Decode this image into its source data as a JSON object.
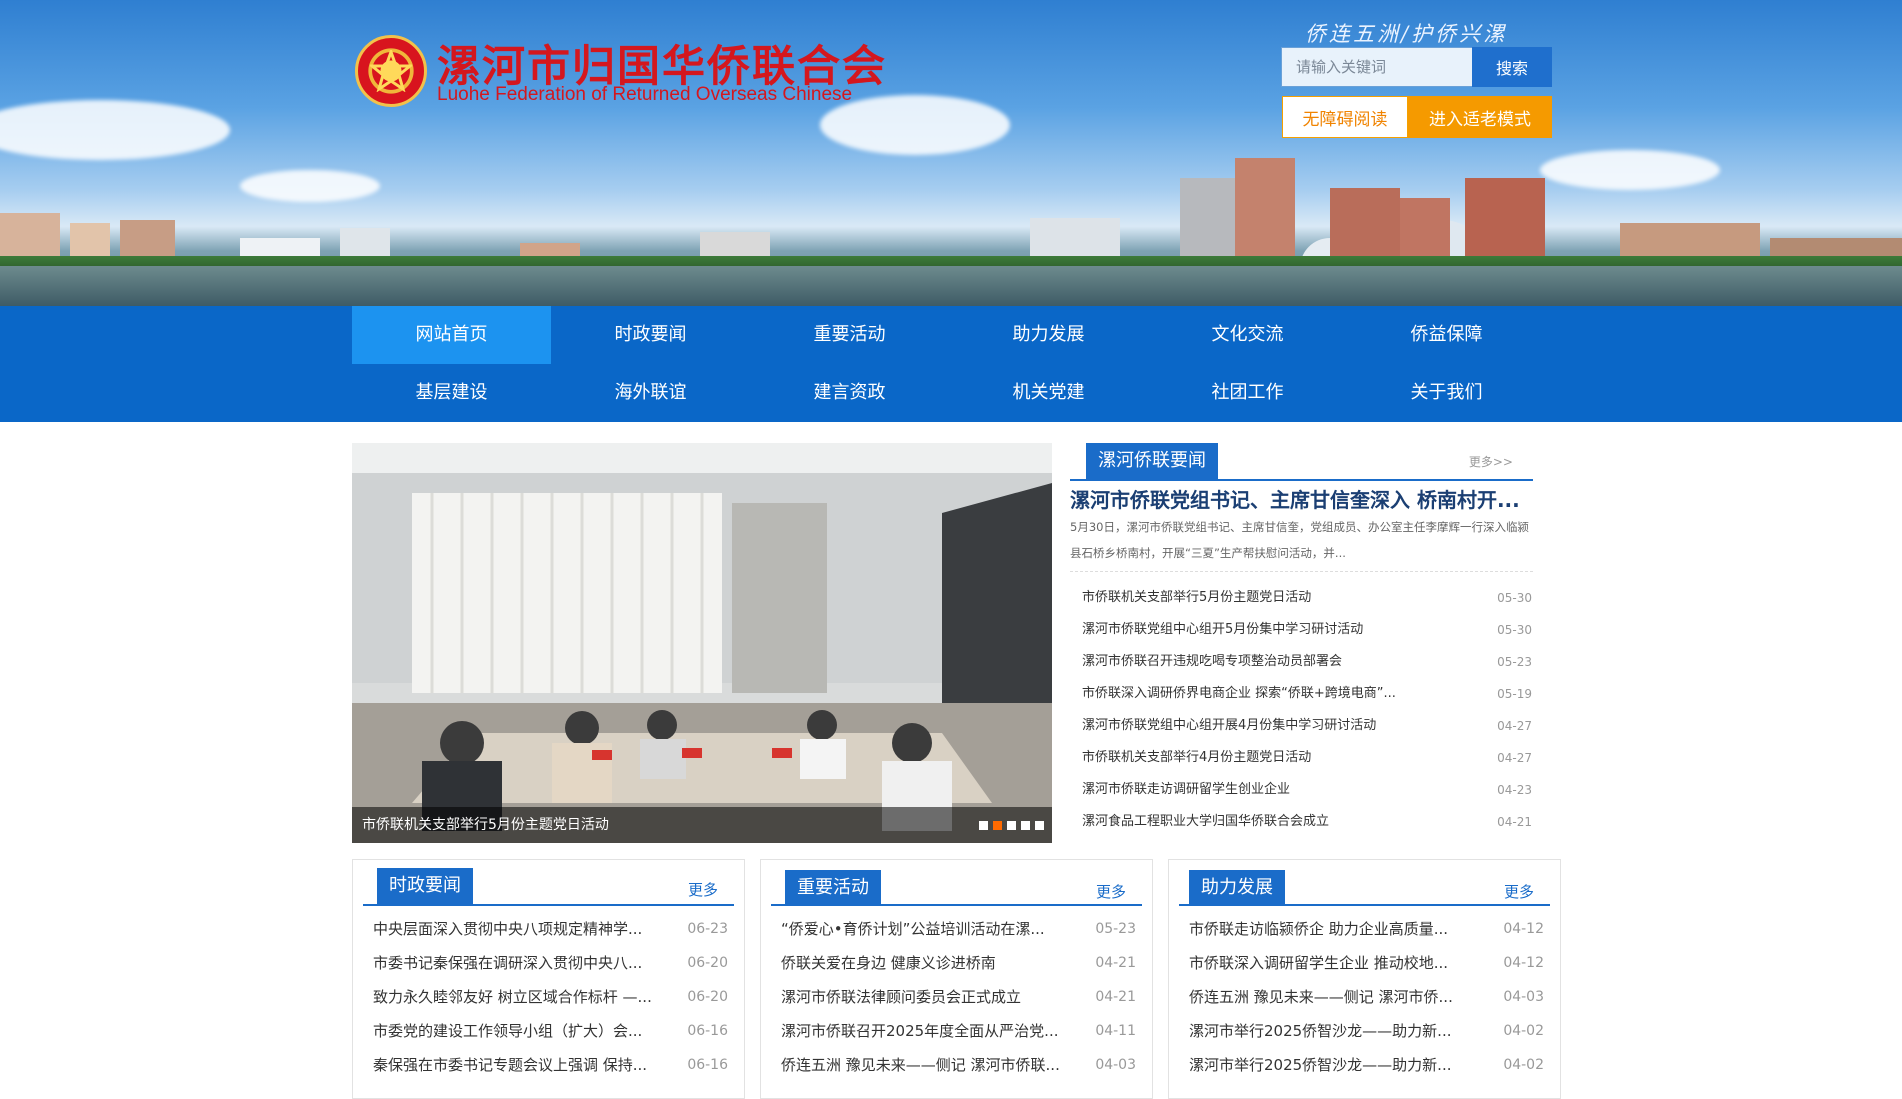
{
  "header": {
    "site_title": "漯河市归国华侨联合会",
    "site_subtitle": "Luohe Federation of Returned Overseas Chinese",
    "slogan": "侨连五洲/护侨兴漯",
    "search_placeholder": "请输入关键词",
    "search_button": "搜索",
    "accessible_button": "无障碍阅读",
    "elder_mode_button": "进入适老模式"
  },
  "nav": {
    "row1": [
      "网站首页",
      "时政要闻",
      "重要活动",
      "助力发展",
      "文化交流",
      "侨益保障"
    ],
    "row2": [
      "基层建设",
      "海外联谊",
      "建言资政",
      "机关党建",
      "社团工作",
      "关于我们"
    ]
  },
  "slider": {
    "caption": "市侨联机关支部举行5月份主题党日活动",
    "dots": 5,
    "active_dot": 1
  },
  "headline_news": {
    "tab": "漯河侨联要闻",
    "more": "更多>>",
    "headline": "漯河市侨联党组书记、主席甘信奎深入 桥南村开...",
    "summary": "5月30日，漯河市侨联党组书记、主席甘信奎，党组成员、办公室主任李摩辉一行深入临颍县石桥乡桥南村，开展“三夏”生产帮扶慰问活动，并...",
    "items": [
      {
        "title": "市侨联机关支部举行5月份主题党日活动",
        "date": "05-30"
      },
      {
        "title": "漯河市侨联党组中心组开5月份集中学习研讨活动",
        "date": "05-30"
      },
      {
        "title": "漯河市侨联召开违规吃喝专项整治动员部署会",
        "date": "05-23"
      },
      {
        "title": "市侨联深入调研侨界电商企业 探索“侨联+跨境电商”...",
        "date": "05-19"
      },
      {
        "title": "漯河市侨联党组中心组开展4月份集中学习研讨活动",
        "date": "04-27"
      },
      {
        "title": "市侨联机关支部举行4月份主题党日活动",
        "date": "04-27"
      },
      {
        "title": "漯河市侨联走访调研留学生创业企业",
        "date": "04-23"
      },
      {
        "title": "漯河食品工程职业大学归国华侨联合会成立",
        "date": "04-21"
      }
    ]
  },
  "columns": [
    {
      "tab": "时政要闻",
      "more": "更多",
      "items": [
        {
          "title": "中央层面深入贯彻中央八项规定精神学...",
          "date": "06-23"
        },
        {
          "title": "市委书记秦保强在调研深入贯彻中央八...",
          "date": "06-20"
        },
        {
          "title": "致力永久睦邻友好 树立区域合作标杆 —...",
          "date": "06-20"
        },
        {
          "title": "市委党的建设工作领导小组（扩大）会...",
          "date": "06-16"
        },
        {
          "title": "秦保强在市委书记专题会议上强调 保持...",
          "date": "06-16"
        }
      ]
    },
    {
      "tab": "重要活动",
      "more": "更多",
      "items": [
        {
          "title": "“侨爱心•育侨计划”公益培训活动在漯...",
          "date": "05-23"
        },
        {
          "title": "侨联关爱在身边 健康义诊进桥南",
          "date": "04-21"
        },
        {
          "title": "漯河市侨联法律顾问委员会正式成立",
          "date": "04-21"
        },
        {
          "title": "漯河市侨联召开2025年度全面从严治党...",
          "date": "04-11"
        },
        {
          "title": "侨连五洲 豫见未来——侧记 漯河市侨联...",
          "date": "04-03"
        }
      ]
    },
    {
      "tab": "助力发展",
      "more": "更多",
      "items": [
        {
          "title": "市侨联走访临颍侨企 助力企业高质量...",
          "date": "04-12"
        },
        {
          "title": "市侨联深入调研留学生企业 推动校地...",
          "date": "04-12"
        },
        {
          "title": "侨连五洲 豫见未来——侧记 漯河市侨...",
          "date": "04-03"
        },
        {
          "title": "漯河市举行2025侨智沙龙——助力新...",
          "date": "04-02"
        },
        {
          "title": "漯河市举行2025侨智沙龙——助力新...",
          "date": "04-02"
        }
      ]
    }
  ]
}
